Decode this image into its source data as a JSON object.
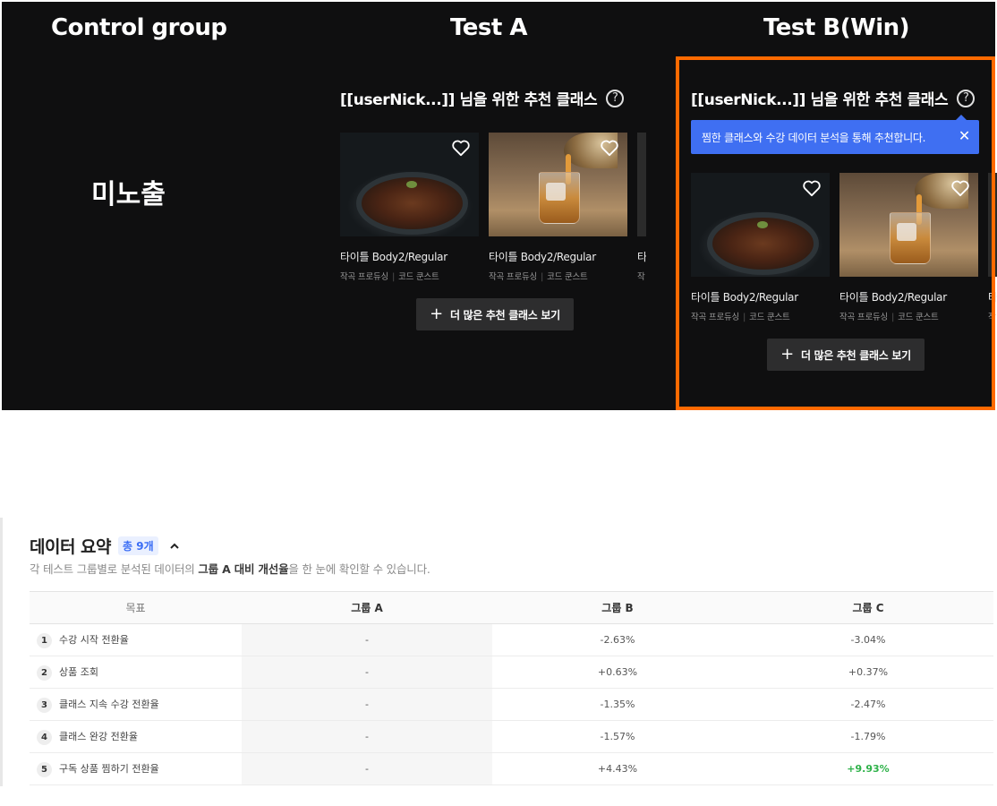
{
  "columns": {
    "control": "Control group",
    "test_a": "Test A",
    "test_b": "Test B(Win)"
  },
  "control_label": "미노출",
  "widget": {
    "heading": "[[userNick...]] 님을 위한 추천 클래스",
    "help_icon": "?",
    "tooltip": "찜한 클래스와 수강 데이터 분석을 통해 추천합니다.",
    "tooltip_close": "✕",
    "cards": [
      {
        "title": "타이틀 Body2/Regular",
        "meta1": "작곡 프로듀싱",
        "meta2": "코드 쿤스트",
        "image": "food-bowl"
      },
      {
        "title": "타이틀 Body2/Regular",
        "meta1": "작곡 프로듀싱",
        "meta2": "코드 쿤스트",
        "image": "whiskey-glass"
      }
    ],
    "partial_title": "타",
    "partial_meta": "작",
    "more_plus": "+",
    "more_label": "더 많은 추천 클래스 보기"
  },
  "summary": {
    "title": "데이터 요약",
    "badge": "총 9개",
    "desc_pre": "각 테스트 그룹별로 분석된 데이터의 ",
    "desc_bold": "그룹 A 대비 개선율",
    "desc_post": "을 한 눈에 확인할 수 있습니다.",
    "headers": {
      "goal": "목표",
      "a": "그룹 A",
      "b": "그룹 B",
      "c": "그룹 C"
    },
    "rows": [
      {
        "no": "1",
        "goal": "수강 시작 전환율",
        "a": "-",
        "b": "-2.63%",
        "c": "-3.04%"
      },
      {
        "no": "2",
        "goal": "상품 조회",
        "a": "-",
        "b": "+0.63%",
        "c": "+0.37%"
      },
      {
        "no": "3",
        "goal": "클래스 지속 수강 전환율",
        "a": "-",
        "b": "-1.35%",
        "c": "-2.47%"
      },
      {
        "no": "4",
        "goal": "클래스 완강 전환율",
        "a": "-",
        "b": "-1.57%",
        "c": "-1.79%"
      },
      {
        "no": "5",
        "goal": "구독 상품 찜하기 전환율",
        "a": "-",
        "b": "+4.43%",
        "c": "+9.93%"
      }
    ]
  },
  "colors": {
    "win_border": "#ff6a00",
    "tooltip": "#3f6ff2",
    "positive": "#2fb24a"
  }
}
